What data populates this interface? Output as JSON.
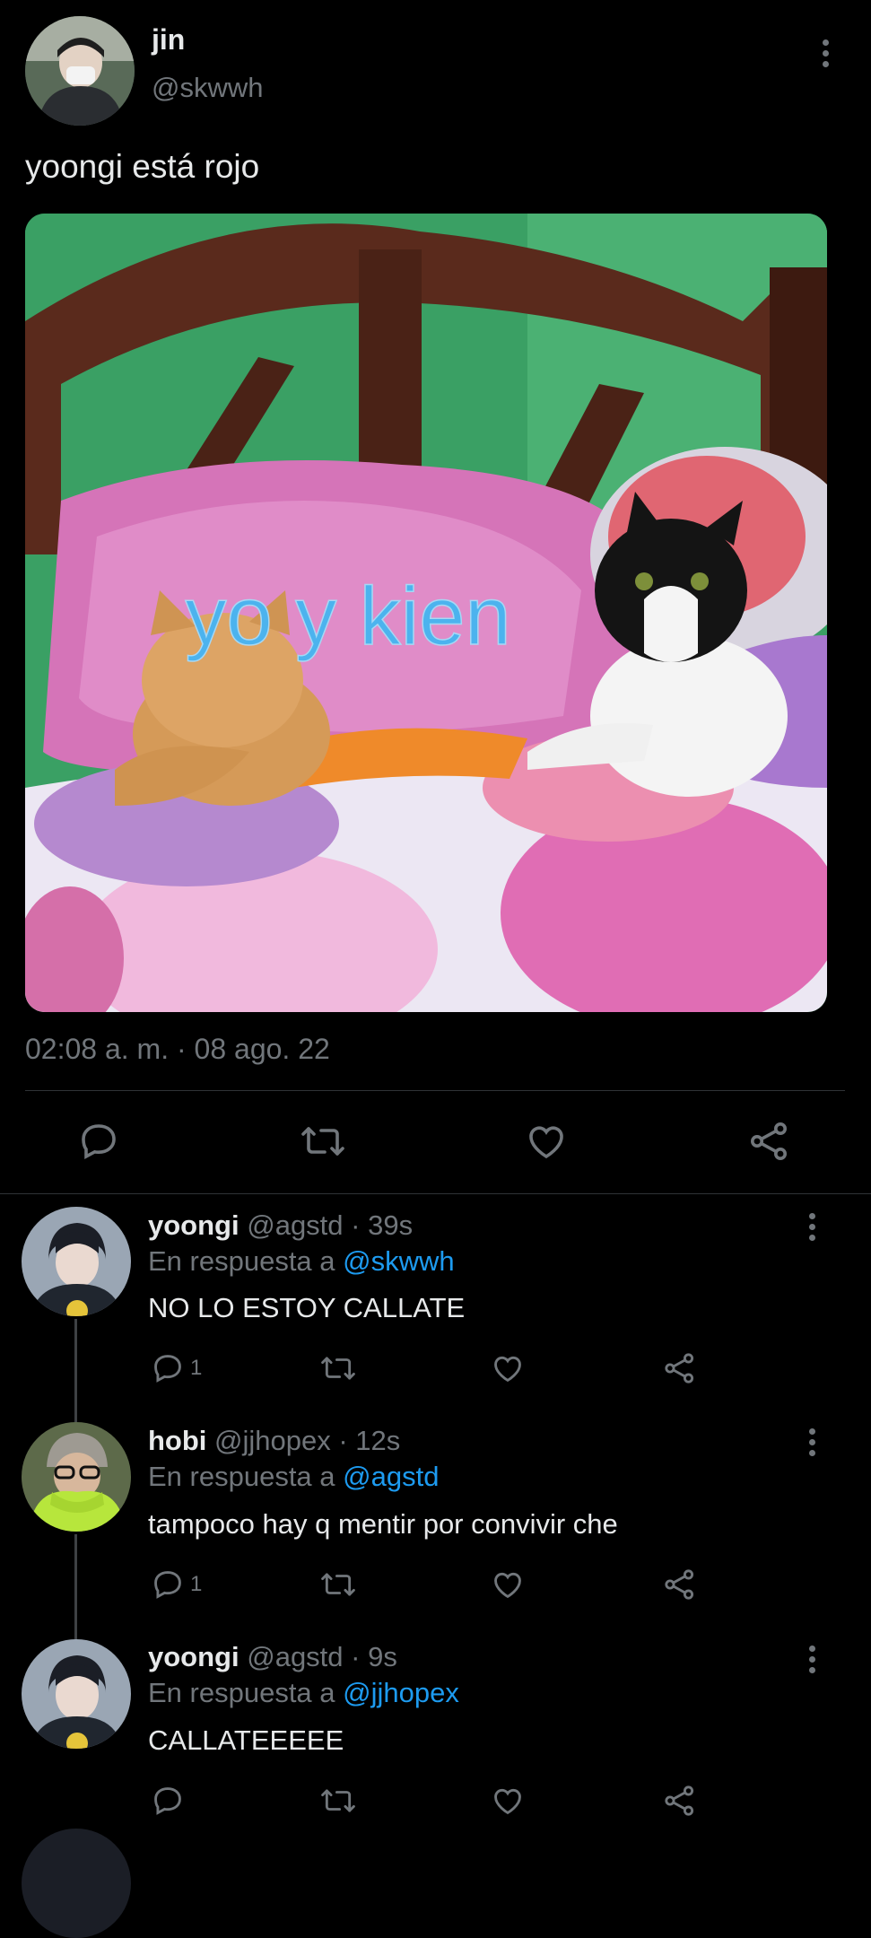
{
  "main_tweet": {
    "display_name": "jin",
    "handle": "@skwwh",
    "text": "yoongi está rojo",
    "image_caption": "yo y kien",
    "timestamp": "02:08 a. m. · 08 ago. 22"
  },
  "replies": [
    {
      "display_name": "yoongi",
      "handle_time": "@agstd · 39s",
      "reply_prefix": "En respuesta a",
      "reply_to": "@skwwh",
      "text": "NO LO ESTOY CALLATE",
      "reply_count": "1"
    },
    {
      "display_name": "hobi",
      "handle_time": "@jjhopex · 12s",
      "reply_prefix": "En respuesta a",
      "reply_to": "@agstd",
      "text": "tampoco hay q mentir por convivir che",
      "reply_count": "1"
    },
    {
      "display_name": "yoongi",
      "handle_time": "@agstd · 9s",
      "reply_prefix": "En respuesta a",
      "reply_to": "@jjhopex",
      "text": "CALLATEEEEE",
      "reply_count": ""
    }
  ],
  "icons": {
    "reply": "reply-icon",
    "retweet": "retweet-icon",
    "like": "heart-icon",
    "share": "share-icon",
    "more": "more-vertical-icon"
  },
  "colors": {
    "background": "#000000",
    "text": "#e7e9ea",
    "muted": "#71767b",
    "link": "#1d9bf0"
  }
}
